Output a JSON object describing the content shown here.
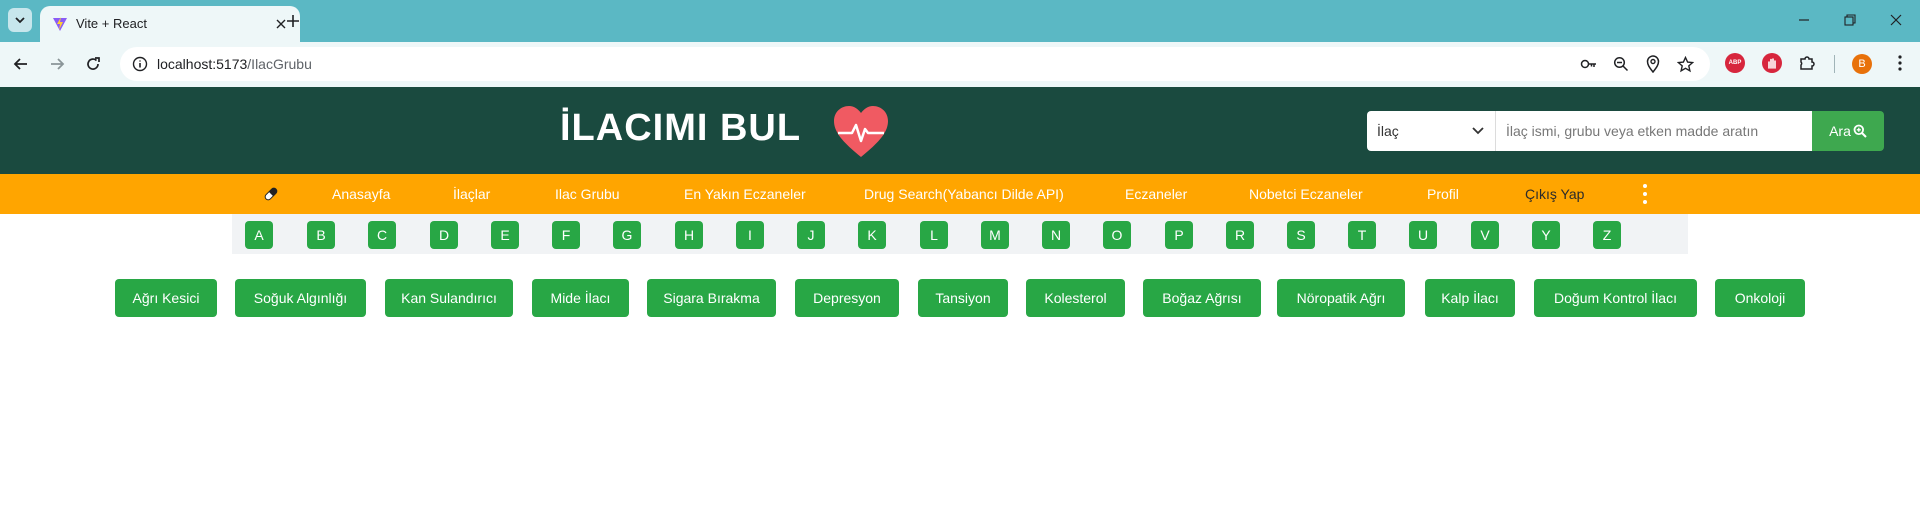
{
  "browser": {
    "tab_title": "Vite + React",
    "url_host": "localhost:5173",
    "url_path": "/IlacGrubu",
    "profile_initial": "B",
    "extension_abp_label": "ABP"
  },
  "header": {
    "logo": "İLACIMI BUL",
    "search": {
      "select_value": "İlaç",
      "placeholder": "İlaç ismi, grubu veya etken madde aratın",
      "button_label": "Ara"
    }
  },
  "nav": {
    "items": [
      "Anasayfa",
      "İlaçlar",
      "Ilac Grubu",
      "En Yakın Eczaneler",
      "Drug Search(Yabancı Dilde API)",
      "Eczaneler",
      "Nobetci Eczaneler",
      "Profil",
      "Çıkış Yap"
    ]
  },
  "letters": [
    "A",
    "B",
    "C",
    "D",
    "E",
    "F",
    "G",
    "H",
    "I",
    "J",
    "K",
    "L",
    "M",
    "N",
    "O",
    "P",
    "R",
    "S",
    "T",
    "U",
    "V",
    "Y",
    "Z"
  ],
  "categories": [
    "Ağrı Kesici",
    "Soğuk Algınlığı",
    "Kan Sulandırıcı",
    "Mide İlacı",
    "Sigara Bırakma",
    "Depresyon",
    "Tansiyon",
    "Kolesterol",
    "Boğaz Ağrısı",
    "Nöropatik Ağrı",
    "Kalp İlacı",
    "Doğum Kontrol İlacı",
    "Onkoloji"
  ],
  "colors": {
    "header_bg": "#1a4a3f",
    "nav_bg": "#ffa500",
    "button_green": "#28a745",
    "search_green": "#3ea84f",
    "heart": "#f05a62"
  }
}
